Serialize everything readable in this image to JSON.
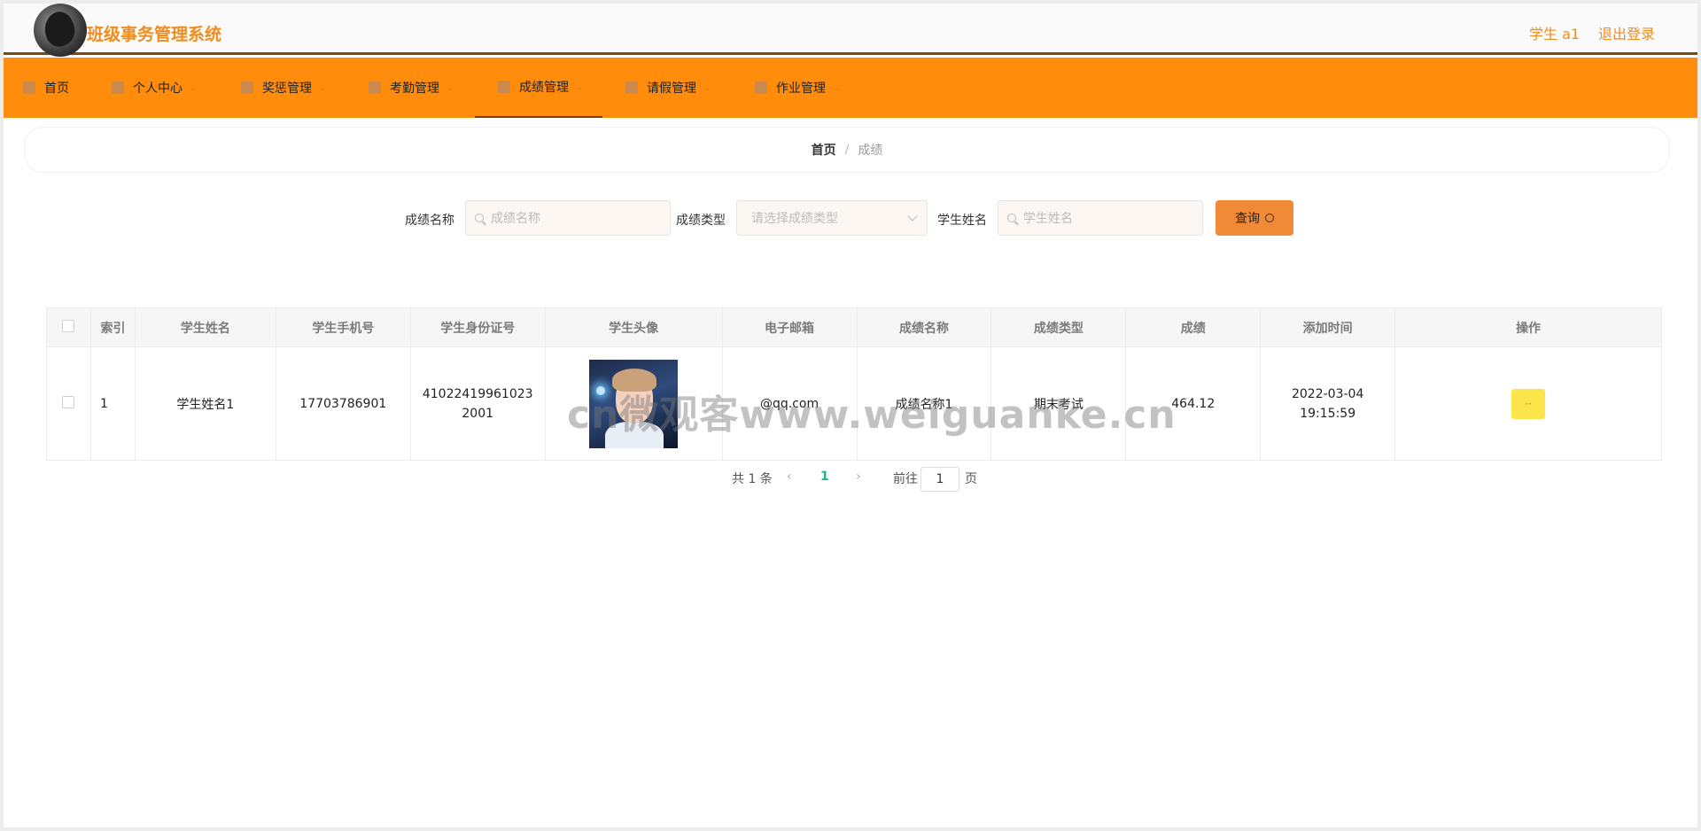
{
  "header": {
    "title": "班级事务管理系统",
    "user": "学生 a1",
    "logout": "退出登录"
  },
  "nav": [
    {
      "label": "首页",
      "icon": "home-icon"
    },
    {
      "label": "个人中心",
      "icon": "user-icon"
    },
    {
      "label": "奖惩管理",
      "icon": "chat-icon"
    },
    {
      "label": "考勤管理",
      "icon": "grid-icon"
    },
    {
      "label": "成绩管理",
      "icon": "chart-icon"
    },
    {
      "label": "请假管理",
      "icon": "pin-icon"
    },
    {
      "label": "作业管理",
      "icon": "phone-icon"
    }
  ],
  "breadcrumb": {
    "home": "首页",
    "sep": "/",
    "current": "成绩"
  },
  "filters": {
    "name_label": "成绩名称",
    "name_placeholder": "成绩名称",
    "type_label": "成绩类型",
    "type_placeholder": "请选择成绩类型",
    "student_label": "学生姓名",
    "student_placeholder": "学生姓名",
    "query": "查询"
  },
  "table": {
    "headers": [
      "索引",
      "学生姓名",
      "学生手机号",
      "学生身份证号",
      "学生头像",
      "电子邮箱",
      "成绩名称",
      "成绩类型",
      "成绩",
      "添加时间",
      "操作"
    ],
    "rows": [
      {
        "index": "1",
        "name": "学生姓名1",
        "phone": "17703786901",
        "id_card": "410224199610232001",
        "email": "@qq.com",
        "score_name": "成绩名称1",
        "score_type": "期末考试",
        "score": "464.12",
        "time": "2022-03-04 19:15:59",
        "op": "··"
      }
    ]
  },
  "watermark": "cn微观客www.weiguanke.cn",
  "pagination": {
    "total": "共 1 条",
    "prev": "‹",
    "page": "1",
    "next": "›",
    "goto": "前往",
    "goto_value": "1",
    "page_unit": "页"
  }
}
